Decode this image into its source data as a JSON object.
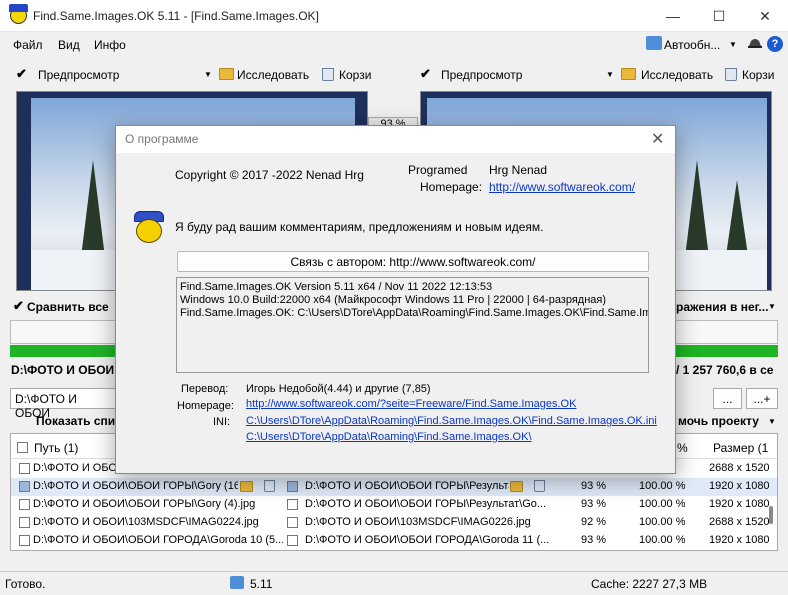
{
  "window": {
    "title": "Find.Same.Images.OK 5.11 - [Find.Same.Images.OK]",
    "minimize": "—",
    "maximize": "☐",
    "close": "✕"
  },
  "menu": {
    "file": "Файл",
    "view": "Вид",
    "info": "Инфо",
    "auto": "Автообн...",
    "auto_arrow": "▼",
    "help": "?"
  },
  "left_pane": {
    "preview_label": "Предпросмотр",
    "explore": "Исследовать",
    "trash": "Корзи"
  },
  "right_pane": {
    "preview_label": "Предпросмотр",
    "explore": "Исследовать",
    "trash": "Корзи"
  },
  "match_pct": "93 %",
  "compare_all": "Сравнить все",
  "right_ctrl": "ражения в нег...",
  "path_left": "D:\\ФОТО И ОБОИ",
  "path_right": "/ 1 257 760,6 в се",
  "combo_left": "D:\\ФОТО И ОБОИ",
  "btn_dots1": "...",
  "btn_dots2": "...+",
  "show_list": "Показать спис",
  "default_project": "мочь проекту",
  "grid": {
    "headers": {
      "path": "Путь (1)",
      "pct": "%",
      "size": "Размер (1"
    },
    "rows": [
      {
        "left": "D:\\ФОТО И ОБОИ",
        "right": "",
        "pct1": "",
        "pct2": "",
        "size": "2688 x 1520"
      },
      {
        "left": "D:\\ФОТО И ОБОИ\\ОБОИ ГОРЫ\\Gory (16)",
        "right": "D:\\ФОТО И ОБОИ\\ОБОИ ГОРЫ\\Результа",
        "pct1": "93 %",
        "pct2": "100.00 %",
        "size": "1920 x 1080"
      },
      {
        "left": "D:\\ФОТО И ОБОИ\\ОБОИ ГОРЫ\\Gory (4).jpg",
        "right": "D:\\ФОТО И ОБОИ\\ОБОИ ГОРЫ\\Результат\\Go...",
        "pct1": "93 %",
        "pct2": "100.00 %",
        "size": "1920 x 1080"
      },
      {
        "left": "D:\\ФОТО И ОБОИ\\103MSDCF\\IMAG0224.jpg",
        "right": "D:\\ФОТО И ОБОИ\\103MSDCF\\IMAG0226.jpg",
        "pct1": "92 %",
        "pct2": "100.00 %",
        "size": "2688 x 1520"
      },
      {
        "left": "D:\\ФОТО И ОБОИ\\ОБОИ ГОРОДА\\Goroda 10 (5...",
        "right": "D:\\ФОТО И ОБОИ\\ОБОИ ГОРОДА\\Goroda 11 (...",
        "pct1": "93 %",
        "pct2": "100.00 %",
        "size": "1920 x 1080"
      }
    ]
  },
  "status": {
    "ready": "Готово.",
    "version": "5.11",
    "cache": "Cache: 2227 27,3 MB"
  },
  "dialog": {
    "title": "О программе",
    "close": "✕",
    "copyright": "Copyright © 2017 -2022 Nenad Hrg",
    "programed_label": "Programed",
    "programed_value": "Hrg Nenad",
    "homepage_label": "Homepage:",
    "homepage_url": "http://www.softwareok.com/",
    "message": "Я буду рад вашим комментариям, предложениям и новым идеям.",
    "contact_button": "Связь с автором: http://www.softwareok.com/",
    "info_lines": [
      "Find.Same.Images.OK Version 5.11  x64  /  Nov 11 2022 12:13:53",
      "Windows 10.0 Build:22000 x64 (Майкрософт Windows 11 Pro | 22000 | 64-разрядная)",
      "Find.Same.Images.OK: C:\\Users\\DTore\\AppData\\Roaming\\Find.Same.Images.OK\\Find.Same.Ima"
    ],
    "translation_label": "Перевод:",
    "translation_value": "Игорь Недобой(4.44) и другие  (7,85)",
    "homepage2_label": "Homepage:",
    "homepage2_url": "http://www.softwareok.com/?seite=Freeware/Find.Same.Images.OK",
    "ini_label": "INI:",
    "ini_path1": "C:\\Users\\DTore\\AppData\\Roaming\\Find.Same.Images.OK\\Find.Same.Images.OK.ini",
    "ini_path2": "C:\\Users\\DTore\\AppData\\Roaming\\Find.Same.Images.OK\\"
  }
}
